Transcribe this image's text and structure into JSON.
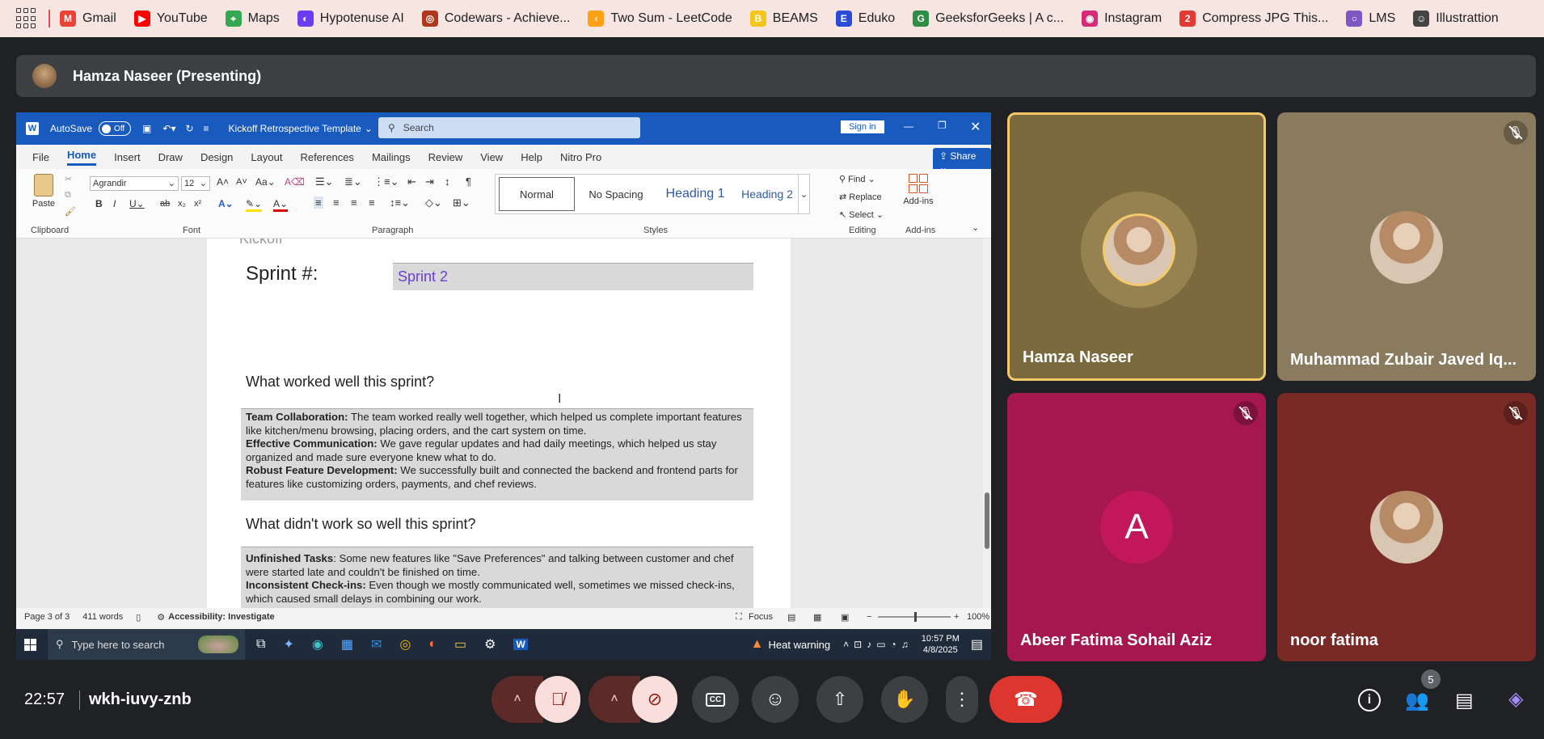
{
  "bookmarks": [
    {
      "label": "Gmail",
      "icon": "gmail-icon",
      "color": "#ea4335",
      "glyph": "M"
    },
    {
      "label": "YouTube",
      "icon": "youtube-icon",
      "color": "#ff0000",
      "glyph": "▶"
    },
    {
      "label": "Maps",
      "icon": "maps-icon",
      "color": "#34a853",
      "glyph": "⌖"
    },
    {
      "label": "Hypotenuse AI",
      "icon": "hypotenuse-icon",
      "color": "#6b3df0",
      "glyph": "◐"
    },
    {
      "label": "Codewars - Achieve...",
      "icon": "codewars-icon",
      "color": "#b1361e",
      "glyph": "◎"
    },
    {
      "label": "Two Sum - LeetCode",
      "icon": "leetcode-icon",
      "color": "#ffa116",
      "glyph": "‹"
    },
    {
      "label": "BEAMS",
      "icon": "beams-icon",
      "color": "#f5c518",
      "glyph": "B"
    },
    {
      "label": "Eduko",
      "icon": "eduko-icon",
      "color": "#2a4bd7",
      "glyph": "E"
    },
    {
      "label": "GeeksforGeeks | A c...",
      "icon": "gfg-icon",
      "color": "#2f8d46",
      "glyph": "G"
    },
    {
      "label": "Instagram",
      "icon": "instagram-icon",
      "color": "#d62976",
      "glyph": "◉"
    },
    {
      "label": "Compress JPG This...",
      "icon": "compress-icon",
      "color": "#e53935",
      "glyph": "2"
    },
    {
      "label": "LMS",
      "icon": "lms-icon",
      "color": "#7e57c2",
      "glyph": "○"
    },
    {
      "label": "Illustrattion",
      "icon": "illustration-icon",
      "color": "#444444",
      "glyph": "☺"
    }
  ],
  "presenting": {
    "label": "Hamza Naseer (Presenting)"
  },
  "word": {
    "autosave": "AutoSave",
    "autosave_state": "Off",
    "doc_title": "Kickoff Retrospective Template",
    "search_placeholder": "Search",
    "signin": "Sign in",
    "share": "Share",
    "tabs": [
      "File",
      "Home",
      "Insert",
      "Draw",
      "Design",
      "Layout",
      "References",
      "Mailings",
      "Review",
      "View",
      "Help",
      "Nitro Pro"
    ],
    "active_tab": "Home",
    "font_name": "Agrandir",
    "font_size": "12",
    "paste": "Paste",
    "styles": [
      "Normal",
      "No Spacing",
      "Heading 1",
      "Heading 2"
    ],
    "find": "Find",
    "replace": "Replace",
    "select": "Select",
    "addins": "Add-ins",
    "groups": [
      "Clipboard",
      "Font",
      "Paragraph",
      "Styles",
      "Editing",
      "Add-ins"
    ],
    "doc": {
      "logo_fragment": "Kickoff",
      "sprint_label": "Sprint #:",
      "sprint_value": "Sprint 2",
      "worked_heading": "What worked well this sprint?",
      "worked_items": [
        {
          "bold": "Team Collaboration:",
          "text": " The team worked really well together, which helped us complete important features like kitchen/menu browsing, placing orders, and the cart system on time."
        },
        {
          "bold": "Effective Communication:",
          "text": " We gave regular updates and had daily meetings, which helped us stay organized and made sure everyone knew what to do."
        },
        {
          "bold": "Robust Feature Development:",
          "text": " We successfully built and connected the backend and frontend parts for features like customizing orders, payments, and chef reviews."
        }
      ],
      "didnt_heading": "What didn't work so well this sprint?",
      "didnt_items": [
        {
          "bold": "Unfinished Tasks",
          "text": ": Some new features like \"Save Preferences\" and talking between customer and chef were started late and couldn't be finished on time."
        },
        {
          "bold": "Inconsistent Check-ins:",
          "text": " Even though we mostly communicated well, sometimes we missed check-ins, which caused small delays in combining our work."
        }
      ]
    },
    "status": {
      "page": "Page 3 of 3",
      "words": "411 words",
      "accessibility": "Accessibility: Investigate",
      "focus": "Focus",
      "zoom": "100%",
      "zoom_level": 1.0
    }
  },
  "taskbar": {
    "search_placeholder": "Type here to search",
    "weather": "Heat warning",
    "time": "10:57 PM",
    "date": "4/8/2025"
  },
  "participants": [
    {
      "name": "Hamza Naseer",
      "muted": false,
      "active": true,
      "bg": "#7b6a3e"
    },
    {
      "name": "Muhammad Zubair Javed Iq...",
      "muted": true,
      "active": false,
      "bg": "#8a7a5e"
    },
    {
      "name": "Abeer Fatima Sohail Aziz",
      "muted": true,
      "active": false,
      "bg": "#a4184f",
      "initial": "A"
    },
    {
      "name": "noor fatima",
      "muted": true,
      "active": false,
      "bg": "#7a2a26"
    }
  ],
  "meeting": {
    "time": "22:57",
    "code": "wkh-iuvy-znb",
    "people_count": "5"
  }
}
